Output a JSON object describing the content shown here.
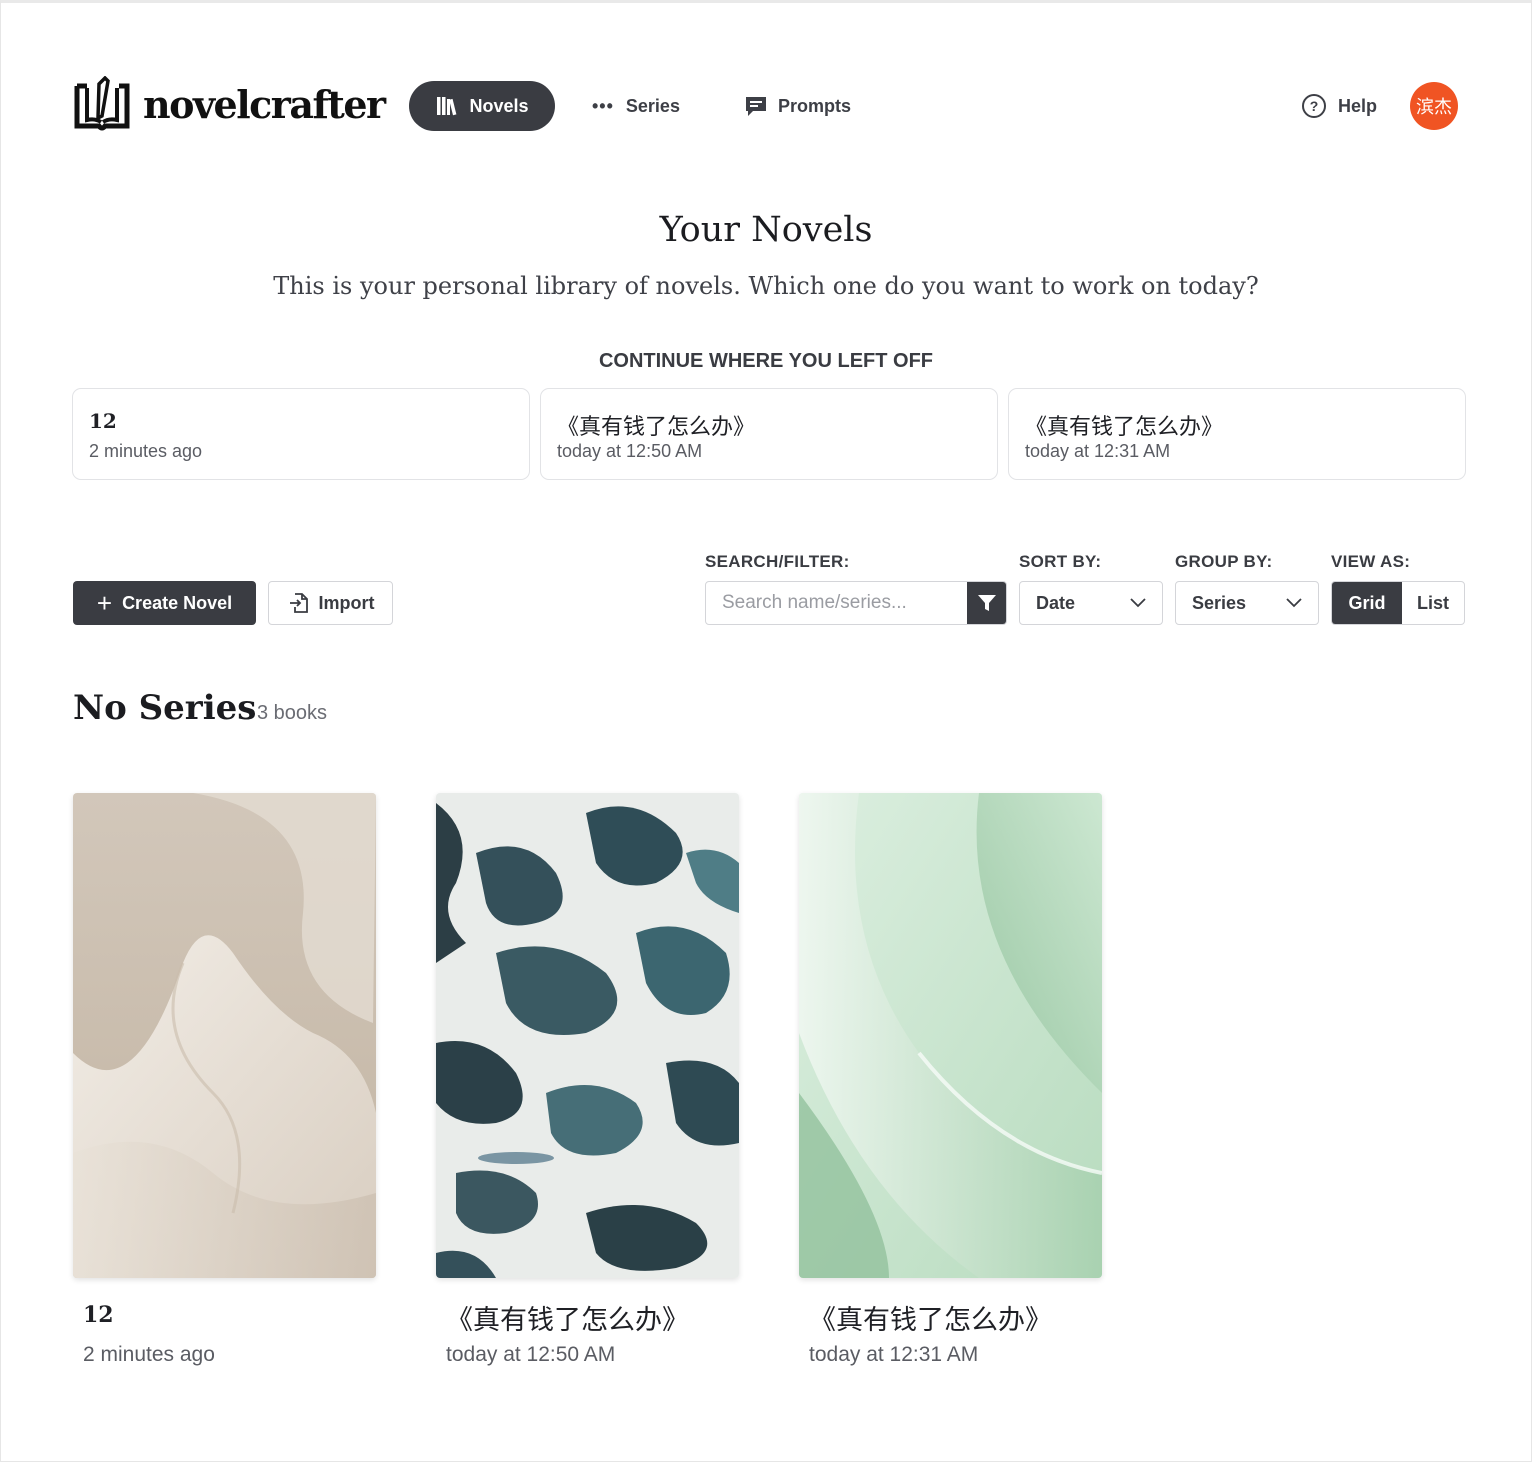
{
  "app": {
    "name": "novelcrafter"
  },
  "nav": {
    "novels": "Novels",
    "series": "Series",
    "prompts": "Prompts",
    "help": "Help",
    "avatar_initials": "滨杰"
  },
  "colors": {
    "accent_dark": "#3a3c42",
    "avatar_bg": "#f05423"
  },
  "header": {
    "title": "Your Novels",
    "subtitle": "This is your personal library of novels. Which one do you want to work on today?"
  },
  "continue": {
    "title": "CONTINUE WHERE YOU LEFT OFF",
    "items": [
      {
        "title": "12",
        "date": "2 minutes ago"
      },
      {
        "title": "《真有钱了怎么办》",
        "date": "today at 12:50 AM"
      },
      {
        "title": "《真有钱了怎么办》",
        "date": "today at 12:31 AM"
      }
    ]
  },
  "toolbar": {
    "create": "Create Novel",
    "import": "Import",
    "search_label": "SEARCH/FILTER:",
    "search_placeholder": "Search name/series...",
    "sort_label": "SORT BY:",
    "sort_value": "Date",
    "group_label": "GROUP BY:",
    "group_value": "Series",
    "view_label": "VIEW AS:",
    "view_grid": "Grid",
    "view_list": "List"
  },
  "group": {
    "title": "No Series",
    "count": "3 books",
    "books": [
      {
        "title": "12",
        "date": "2 minutes ago",
        "cover": "beige-waves"
      },
      {
        "title": "《真有钱了怎么办》",
        "date": "today at 12:50 AM",
        "cover": "ocean-foam"
      },
      {
        "title": "《真有钱了怎么办》",
        "date": "today at 12:31 AM",
        "cover": "green-folds"
      }
    ]
  }
}
